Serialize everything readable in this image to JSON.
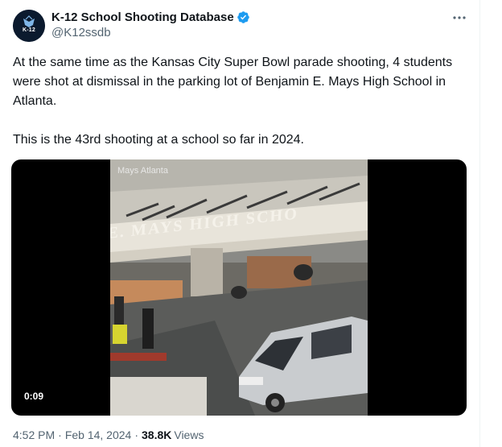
{
  "author": {
    "display_name": "K-12 School Shooting Database",
    "handle": "@K12ssdb",
    "avatar_text": "K-12",
    "verified": true
  },
  "tweet": {
    "text": "At the same time as the Kansas City Super Bowl parade shooting, 4 students were shot at dismissal in the parking lot of Benjamin E. Mays High School in Atlanta.\n\nThis is the 43rd shooting at a school so far in 2024."
  },
  "media": {
    "overlay_caption": "Mays Atlanta",
    "building_sign": "E. MAYS HIGH SCHO",
    "duration": "0:09"
  },
  "meta": {
    "time": "4:52 PM",
    "separator": "·",
    "date": "Feb 14, 2024",
    "views_count": "38.8K",
    "views_label": "Views"
  },
  "colors": {
    "verified": "#1d9bf0",
    "text_primary": "#0f1419",
    "text_secondary": "#536471",
    "media_bg": "#000000"
  },
  "icons": {
    "verified": "verified-badge-icon",
    "more": "more-horizontal-icon"
  }
}
